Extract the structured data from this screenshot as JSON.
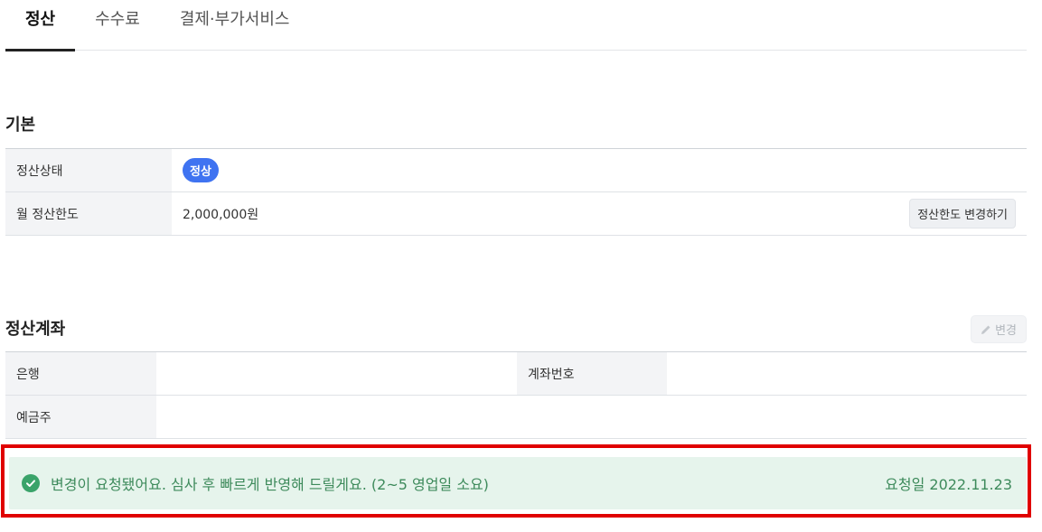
{
  "tabs": [
    {
      "label": "정산",
      "active": true
    },
    {
      "label": "수수료",
      "active": false
    },
    {
      "label": "결제·부가서비스",
      "active": false
    }
  ],
  "basic": {
    "title": "기본",
    "status_label": "정산상태",
    "status_badge": "정상",
    "limit_label": "월 정산한도",
    "limit_value": "2,000,000원",
    "limit_change_button": "정산한도 변경하기"
  },
  "account": {
    "title": "정산계좌",
    "edit_button": "변경",
    "edit_icon": "pencil-icon",
    "bank_label": "은행",
    "bank_value": "",
    "account_number_label": "계좌번호",
    "account_number_value": "",
    "holder_label": "예금주",
    "holder_value": ""
  },
  "notice": {
    "icon": "check-circle-icon",
    "message": "변경이 요청됐어요. 심사 후 빠르게 반영해 드릴게요. (2~5 영업일 소요)",
    "request_date": "요청일 2022.11.23"
  },
  "colors": {
    "accent": "#3f73f1",
    "notice_bg": "#e6f4ec",
    "notice_text": "#3d8a5b",
    "highlight_frame": "#e00000"
  }
}
